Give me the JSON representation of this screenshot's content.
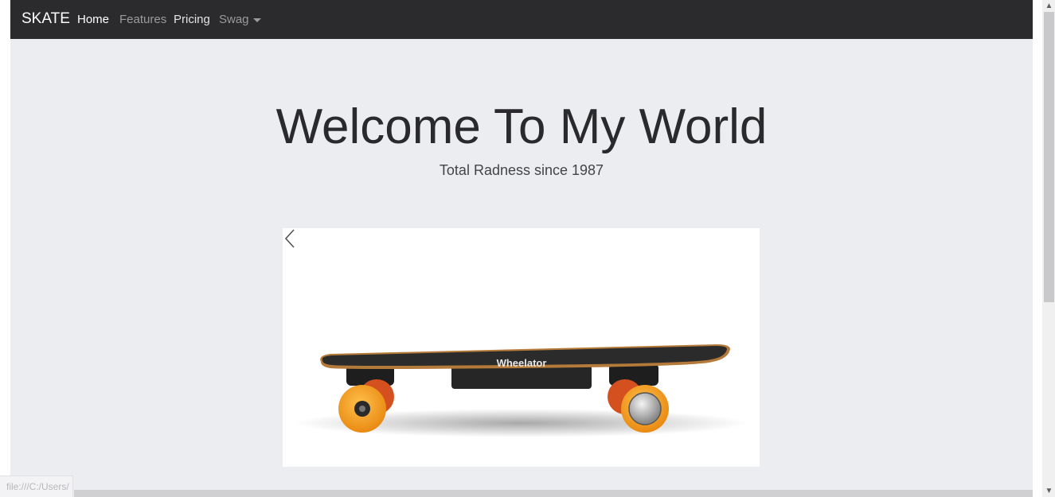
{
  "navbar": {
    "brand": "SKATE",
    "items": [
      {
        "label": "Home"
      },
      {
        "label": "Features"
      },
      {
        "label": "Pricing"
      },
      {
        "label": "Swag"
      }
    ]
  },
  "hero": {
    "title": "Welcome To My World",
    "subtitle": "Total Radness since 1987"
  },
  "carousel": {
    "image": "electric-skateboard-image",
    "prev_icon": "chevron-left-icon",
    "deck_text": "Wheelator"
  },
  "status_bar": {
    "url": "file:///C:/Users/"
  },
  "colors": {
    "navbar_bg": "#2b2b2d",
    "page_bg": "#ecedf0",
    "wheel_orange": "#f2a21f"
  }
}
